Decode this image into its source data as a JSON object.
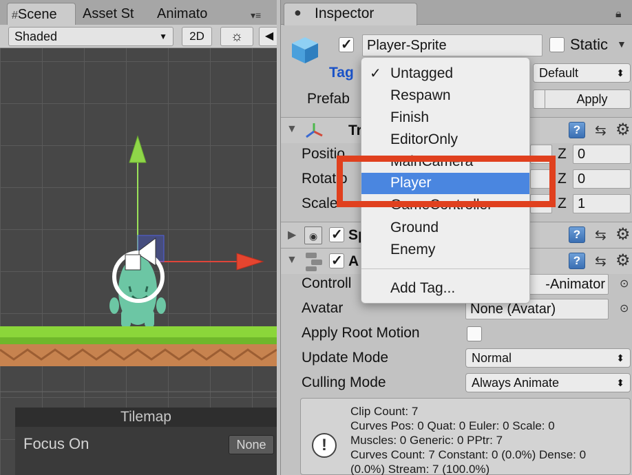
{
  "scene": {
    "tabs": [
      "Scene",
      "Asset St",
      "Animato"
    ],
    "shading_mode": "Shaded",
    "mode_2d": "2D",
    "tilemap_panel": {
      "title": "Tilemap",
      "focus_label": "Focus On",
      "focus_value": "None"
    }
  },
  "inspector": {
    "tab_title": "Inspector",
    "object_name": "Player-Sprite",
    "static_label": "Static",
    "tag_label": "Tag",
    "layer_value": "Default",
    "prefab_label": "Prefab",
    "apply_label": "Apply",
    "transform": {
      "title_partial": "Tr",
      "position_label": "Positio",
      "rotation_label": "Rotatio",
      "scale_label": "Scale",
      "z_label": "Z",
      "position_z": "0",
      "rotation_z": "0",
      "scale_z": "1"
    },
    "sprite_renderer_title": "Sp",
    "animator": {
      "title": "A",
      "controller_label": "Controll",
      "controller_value": "-Animator",
      "avatar_label": "Avatar",
      "avatar_value": "None (Avatar)",
      "apply_root_motion_label": "Apply Root Motion",
      "update_mode_label": "Update Mode",
      "update_mode_value": "Normal",
      "culling_mode_label": "Culling Mode",
      "culling_mode_value": "Always Animate",
      "info_lines": [
        "Clip Count: 7",
        "Curves Pos: 0 Quat: 0 Euler: 0 Scale: 0",
        "Muscles: 0 Generic: 0 PPtr: 7",
        "Curves Count: 7 Constant: 0 (0.0%) Dense: 0",
        "(0.0%) Stream: 7 (100.0%)"
      ]
    }
  },
  "tag_menu": {
    "items": [
      "Untagged",
      "Respawn",
      "Finish",
      "EditorOnly",
      "MainCamera",
      "Player",
      "GameController",
      "Ground",
      "Enemy"
    ],
    "checked_item": "Untagged",
    "highlighted_item": "Player",
    "add_tag_label": "Add Tag..."
  },
  "colors": {
    "selection_blue": "#4a86e0",
    "highlight_box_red": "#e0401e",
    "tag_label_blue": "#1a52c7"
  }
}
